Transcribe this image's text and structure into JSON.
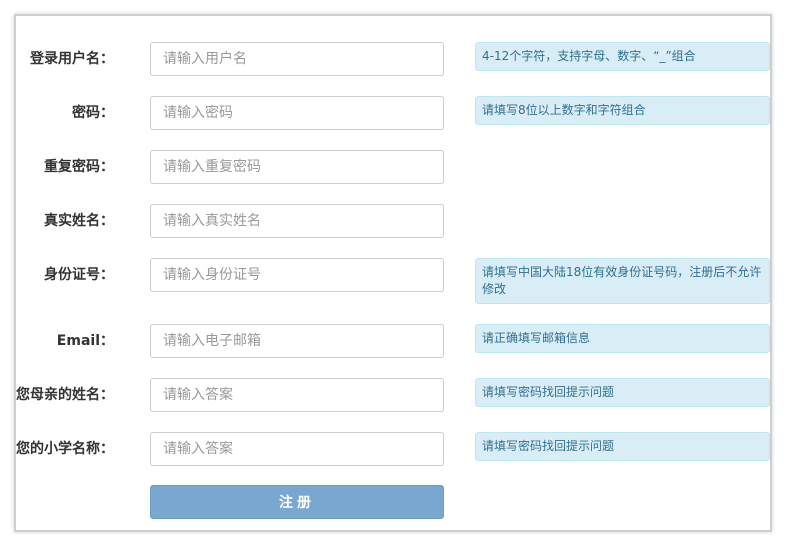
{
  "form": {
    "fields": [
      {
        "label": "登录用户名：",
        "placeholder": "请输入用户名",
        "value": "",
        "hint": "4-12个字符，支持字母、数字、“_”组合"
      },
      {
        "label": "密码：",
        "placeholder": "请输入密码",
        "value": "",
        "hint": "请填写8位以上数字和字符组合"
      },
      {
        "label": "重复密码：",
        "placeholder": "请输入重复密码",
        "value": "",
        "hint": ""
      },
      {
        "label": "真实姓名：",
        "placeholder": "请输入真实姓名",
        "value": "",
        "hint": ""
      },
      {
        "label": "身份证号：",
        "placeholder": "请输入身份证号",
        "value": "",
        "hint": "请填写中国大陆18位有效身份证号码，注册后不允许修改"
      },
      {
        "label": "Email：",
        "placeholder": "请输入电子邮箱",
        "value": "",
        "hint": "请正确填写邮箱信息"
      },
      {
        "label": "您母亲的姓名：",
        "placeholder": "请输入答案",
        "value": "",
        "hint": "请填写密码找回提示问题"
      },
      {
        "label": "您的小学名称：",
        "placeholder": "请输入答案",
        "value": "",
        "hint": "请填写密码找回提示问题"
      }
    ],
    "submit_label": "注册"
  },
  "colors": {
    "hint_background": "#d9edf7",
    "hint_text": "#31708f",
    "button_background": "#7aa7d0"
  }
}
